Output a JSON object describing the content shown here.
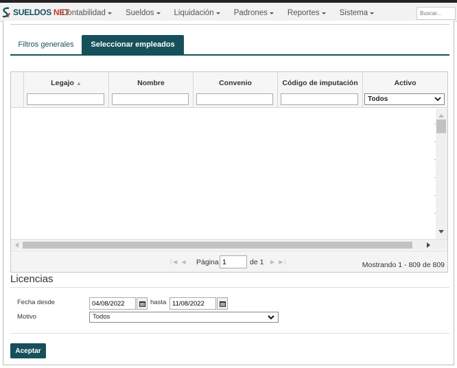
{
  "app": {
    "brand_sueldos": "SUELDOS",
    "brand_net": "NET"
  },
  "nav": {
    "items": [
      {
        "label": "Contabilidad"
      },
      {
        "label": "Sueldos"
      },
      {
        "label": "Liquidación"
      },
      {
        "label": "Padrones"
      },
      {
        "label": "Reportes"
      },
      {
        "label": "Sistema"
      }
    ],
    "search_placeholder": "Buscar..."
  },
  "tabs": [
    {
      "label": "Filtros generales",
      "active": false
    },
    {
      "label": "Seleccionar empleados",
      "active": true
    }
  ],
  "grid": {
    "columns": [
      {
        "label": "Legajo",
        "sortable": true
      },
      {
        "label": "Nombre"
      },
      {
        "label": "Convenio"
      },
      {
        "label": "Código de imputación"
      },
      {
        "label": "Activo"
      }
    ],
    "filters": {
      "legajo": "",
      "nombre": "",
      "convenio": "",
      "codigo": "",
      "activo": "Todos"
    },
    "pager": {
      "page_label": "Página",
      "page_value": "1",
      "of_label": "de 1",
      "showing": "Mostrando 1 - 809 de 809"
    }
  },
  "licencias": {
    "title": "Licencias",
    "fecha_desde_label": "Fecha desde",
    "fecha_desde_value": "04/08/2022",
    "hasta_label": "hasta",
    "hasta_value": "11/08/2022",
    "motivo_label": "Motivo",
    "motivo_value": "Todos"
  },
  "actions": {
    "accept_label": "Aceptar"
  },
  "colors": {
    "accent": "#16505a",
    "brand_red": "#c0392b"
  }
}
